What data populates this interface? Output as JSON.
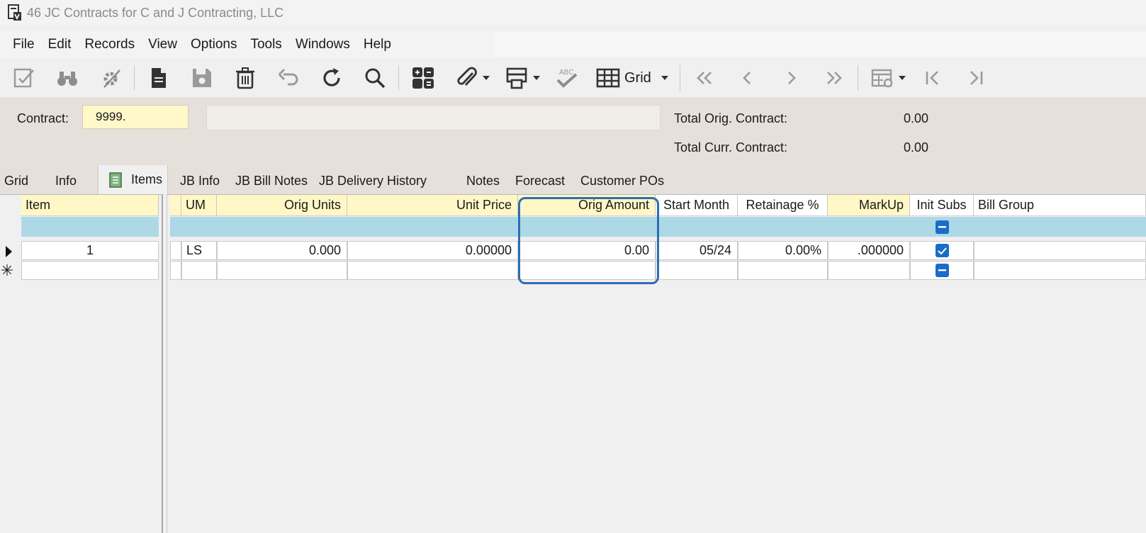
{
  "window": {
    "title": "46 JC Contracts for C and J Contracting, LLC"
  },
  "menu": [
    "File",
    "Edit",
    "Records",
    "View",
    "Options",
    "Tools",
    "Windows",
    "Help"
  ],
  "toolbar": {
    "grid_label": "Grid",
    "icons": [
      "edit-icon",
      "binoculars-icon",
      "settings-gear-icon",
      "new-document-icon",
      "save-icon",
      "delete-icon",
      "undo-icon",
      "refresh-icon",
      "search-icon",
      "calculator-icon",
      "attach-icon",
      "print-icon",
      "spellcheck-icon",
      "grid-icon",
      "first-record-icon",
      "previous-record-icon",
      "next-record-icon",
      "last-record-icon",
      "table-settings-icon",
      "first-page-icon",
      "last-page-icon"
    ]
  },
  "header": {
    "contract_label": "Contract:",
    "contract_value": "9999.",
    "total_orig_label": "Total Orig. Contract:",
    "total_orig_value": "0.00",
    "total_curr_label": "Total Curr. Contract:",
    "total_curr_value": "0.00"
  },
  "tabs": [
    "Grid",
    "Info",
    "Items",
    "JB Info",
    "JB Bill Notes",
    "JB Delivery History",
    "Notes",
    "Forecast",
    "Customer POs"
  ],
  "active_tab": "Items",
  "grid": {
    "left_header": "Item",
    "columns": [
      "UM",
      "Orig Units",
      "Unit Price",
      "Orig Amount",
      "Start Month",
      "Retainage %",
      "MarkUp",
      "Init Subs",
      "Bill Group"
    ],
    "rows": [
      {
        "item": "1",
        "um": "LS",
        "orig_units": "0.000",
        "unit_price": "0.00000",
        "orig_amount": "0.00",
        "start_month": "05/24",
        "retainage": "0.00%",
        "markup": ".000000",
        "init_subs": true,
        "bill_group": ""
      }
    ],
    "highlighted_column": "Orig Amount"
  },
  "colors": {
    "header_yellow": "#fff7c6",
    "filter_row": "#add8e6",
    "panel": "#e6e0da",
    "accent": "#2d6fb0",
    "checkbox": "#1a6dc8"
  }
}
